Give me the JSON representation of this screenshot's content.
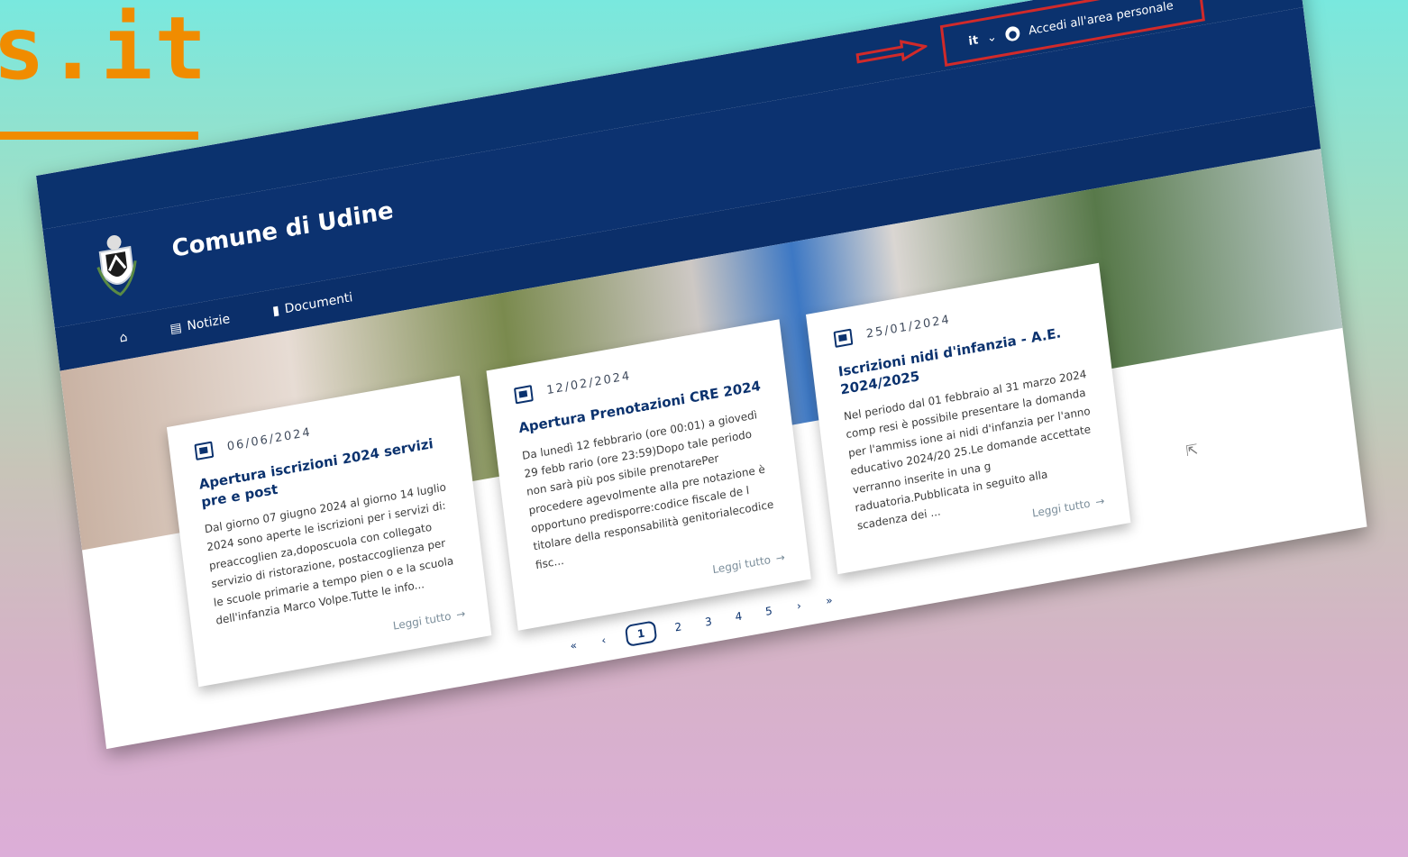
{
  "brand": {
    "fragment": "s.it"
  },
  "slim_header": {
    "language": "it",
    "language_chevron": "⌄",
    "login_label": "Accedi all'area personale"
  },
  "site": {
    "title": "Comune di Udine"
  },
  "nav": {
    "items": [
      {
        "label": "Notizie",
        "icon": "newspaper-icon"
      },
      {
        "label": "Documenti",
        "icon": "document-icon"
      }
    ]
  },
  "cards": [
    {
      "date": "06/06/2024",
      "title": "Apertura iscrizioni 2024 servizi pre e post",
      "text": "Dal giorno 07 giugno 2024 al giorno 14 luglio 2024 sono aperte le iscrizioni per i servizi di: preaccoglien za,doposcuola con collegato servizio di ristorazione, postaccoglienza per le scuole primarie a tempo pien o e la scuola dell'infanzia Marco Volpe.Tutte le info...",
      "read_more": "Leggi tutto"
    },
    {
      "date": "12/02/2024",
      "title": "Apertura Prenotazioni CRE 2024",
      "text": "Da lunedì 12 febbrario (ore 00:01) a giovedì 29 febb rario (ore 23:59)Dopo tale periodo non sarà più pos sibile prenotarePer procedere agevolmente alla pre notazione è opportuno predisporre:codice fiscale de l titolare della responsabilità genitorialecodice fisc...",
      "read_more": "Leggi tutto"
    },
    {
      "date": "25/01/2024",
      "title": "Iscrizioni nidi d'infanzia - A.E. 2024/2025",
      "text": "Nel periodo dal 01 febbraio al 31 marzo 2024 comp resi è possibile presentare la domanda per l'ammiss ione ai nidi d'infanzia per l'anno educativo 2024/20 25.Le domande accettate verranno inserite in una g raduatoria.Pubblicata in seguito alla scadenza dei ...",
      "read_more": "Leggi tutto"
    }
  ],
  "pagination": {
    "first": "«",
    "prev": "‹",
    "pages": [
      "1",
      "2",
      "3",
      "4",
      "5"
    ],
    "next": "›",
    "last": "»"
  },
  "colors": {
    "header_bg": "#0b326e",
    "accent_red": "#d12a2a",
    "brand_orange": "#f08c00"
  }
}
